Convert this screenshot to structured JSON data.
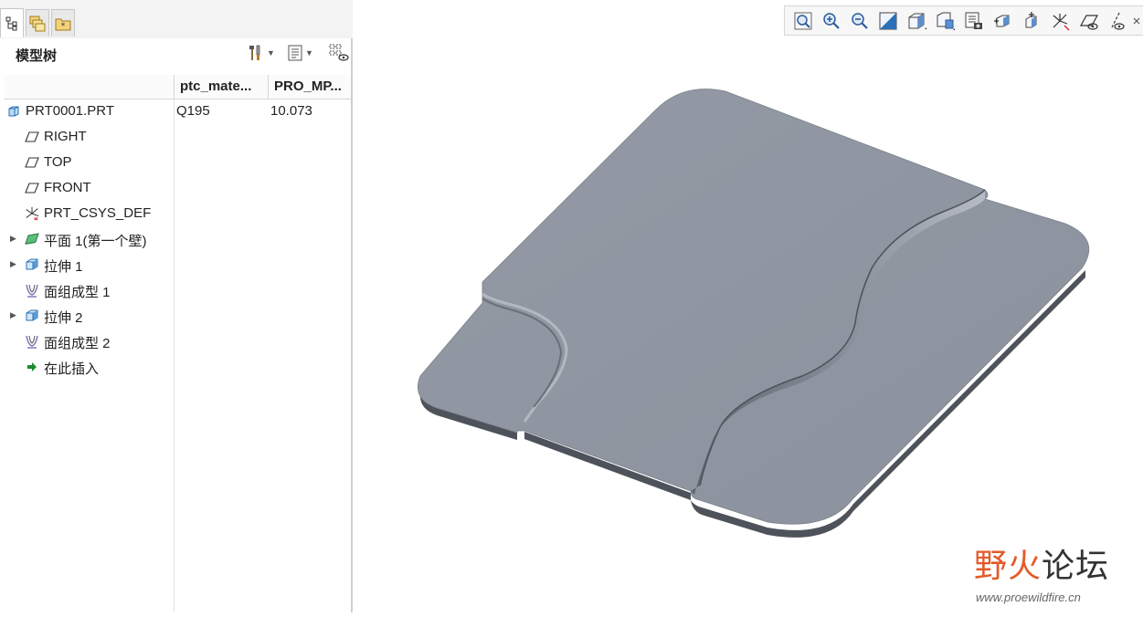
{
  "tabs": [
    {
      "name": "model-tree-tab-icon"
    },
    {
      "name": "layers-tab-icon"
    },
    {
      "name": "favorites-tab-icon"
    }
  ],
  "panel": {
    "title": "模型树",
    "columns": [
      "ptc_mate...",
      "PRO_MP..."
    ],
    "tree": [
      {
        "label": "PRT0001.PRT",
        "icon": "part-icon",
        "expandable": false,
        "indent": 0,
        "col1": "Q195",
        "col2": "10.073"
      },
      {
        "label": "RIGHT",
        "icon": "datum-plane-icon",
        "expandable": false,
        "indent": 1,
        "col1": "",
        "col2": ""
      },
      {
        "label": "TOP",
        "icon": "datum-plane-icon",
        "expandable": false,
        "indent": 1,
        "col1": "",
        "col2": ""
      },
      {
        "label": "FRONT",
        "icon": "datum-plane-icon",
        "expandable": false,
        "indent": 1,
        "col1": "",
        "col2": ""
      },
      {
        "label": "PRT_CSYS_DEF",
        "icon": "csys-icon",
        "expandable": false,
        "indent": 1,
        "col1": "",
        "col2": ""
      },
      {
        "label": "平面 1(第一个壁)",
        "icon": "flat-wall-icon",
        "expandable": true,
        "indent": 1,
        "col1": "",
        "col2": ""
      },
      {
        "label": "拉伸 1",
        "icon": "extrude-icon",
        "expandable": true,
        "indent": 1,
        "col1": "",
        "col2": ""
      },
      {
        "label": "面组成型 1",
        "icon": "form-icon",
        "expandable": false,
        "indent": 1,
        "col1": "",
        "col2": ""
      },
      {
        "label": "拉伸 2",
        "icon": "extrude-icon",
        "expandable": true,
        "indent": 1,
        "col1": "",
        "col2": ""
      },
      {
        "label": "面组成型 2",
        "icon": "form-icon",
        "expandable": false,
        "indent": 1,
        "col1": "",
        "col2": ""
      },
      {
        "label": "在此插入",
        "icon": "insert-here-arrow-icon",
        "expandable": false,
        "indent": 1,
        "col1": "",
        "col2": ""
      }
    ]
  },
  "graphics_toolbar": [
    "refit-icon",
    "zoom-in-icon",
    "zoom-out-icon",
    "repaint-icon",
    "display-style-icon",
    "saved-orientations-icon",
    "view-manager-icon",
    "perspective-icon",
    "spin-center-icon",
    "datum-display-icon",
    "plane-display-icon",
    "axis-display-icon",
    "close-icon"
  ],
  "watermark": {
    "title_a": "野火",
    "title_b": "论坛",
    "url": "www.proewildfire.cn"
  },
  "colors": {
    "part_top": "#8f96a1",
    "part_edge": "#4e535b",
    "watermark": "#e45a2a"
  }
}
